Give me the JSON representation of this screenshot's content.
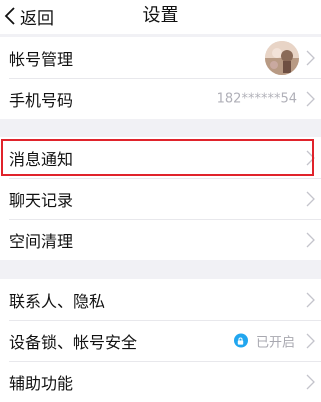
{
  "nav": {
    "back_label": "返回",
    "title": "设置"
  },
  "groups": {
    "account": {
      "account_management": "帐号管理",
      "phone_label": "手机号码",
      "phone_value": "182******54"
    },
    "messages": {
      "notifications": "消息通知",
      "chat_history": "聊天记录",
      "storage_cleanup": "空间清理"
    },
    "privacy": {
      "contacts_privacy": "联系人、隐私",
      "device_lock": "设备锁、帐号安全",
      "device_lock_status": "已开启",
      "accessibility": "辅助功能"
    }
  },
  "colors": {
    "background": "#f1f1f5",
    "highlight_border": "#e0232b",
    "lock_badge": "#21a6ef",
    "secondary_text": "#b0b0b8"
  },
  "icons": [
    "back-chevron-icon",
    "chevron-right-icon",
    "lock-icon",
    "avatar"
  ]
}
